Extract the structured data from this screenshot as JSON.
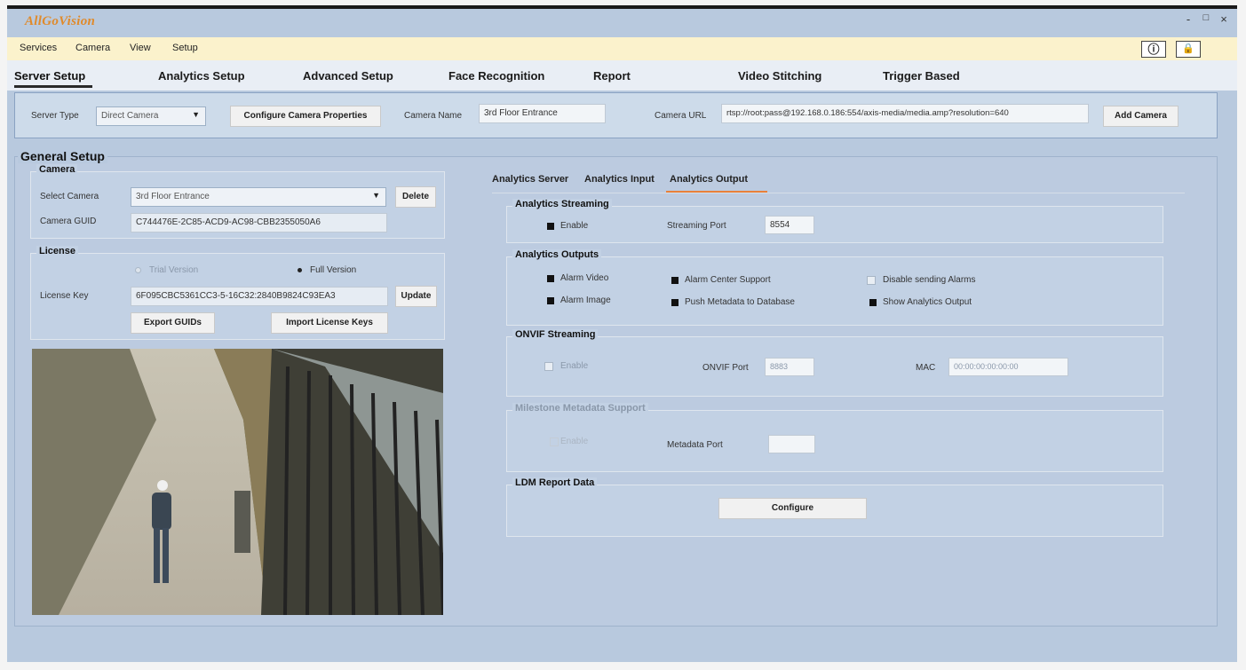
{
  "app": {
    "logo": "AllGoVision",
    "minimize": "-",
    "maximize": "□",
    "close": "×"
  },
  "menu": {
    "items": [
      "Services",
      "Camera",
      "View",
      "Setup"
    ],
    "info_icon": "ⓘ",
    "lock_icon": "🔒"
  },
  "tabs": [
    "Server Setup",
    "Analytics Setup",
    "Advanced Setup",
    "Face Recognition",
    "Report",
    "Video Stitching",
    "Trigger Based"
  ],
  "camera_bar": {
    "server_type_label": "Server Type",
    "server_type_value": "Direct Camera",
    "configure_btn": "Configure Camera Properties",
    "camera_name_label": "Camera Name",
    "camera_name_value": "3rd Floor Entrance",
    "camera_url_label": "Camera URL",
    "camera_url_value": "rtsp://root:pass@192.168.0.186:554/axis-media/media.amp?resolution=640",
    "add_btn": "Add Camera"
  },
  "general": {
    "title": "General Setup",
    "camera": {
      "caption": "Camera",
      "select_label": "Select Camera",
      "select_value": "3rd Floor Entrance",
      "delete_btn": "Delete",
      "guid_label": "Camera GUID",
      "guid_value": "C744476E-2C85-ACD9-AC98-CBB2355050A6"
    },
    "license": {
      "caption": "License",
      "trial": "Trial Version",
      "full": "Full Version",
      "key_label": "License Key",
      "key_value": "6F095CBC5361CC3-5-16C32:2840B9824C93EA3",
      "update_btn": "Update",
      "export_btn": "Export GUIDs",
      "import_btn": "Import License Keys"
    }
  },
  "analytics": {
    "subtabs": [
      "Analytics Server",
      "Analytics Input",
      "Analytics Output"
    ],
    "streaming": {
      "caption": "Analytics Streaming",
      "enable": "Enable",
      "port_label": "Streaming Port",
      "port_value": "8554"
    },
    "outputs": {
      "caption": "Analytics Outputs",
      "alarm_video": "Alarm Video",
      "alarm_image": "Alarm Image",
      "alarm_center": "Alarm Center Support",
      "push_metadata": "Push Metadata to Database",
      "disable_alarms": "Disable sending Alarms",
      "show_output": "Show Analytics Output"
    },
    "onvif": {
      "caption": "ONVIF Streaming",
      "enable": "Enable",
      "port_label": "ONVIF Port",
      "port_value": "8883",
      "mac_label": "MAC",
      "mac_value": "00:00:00:00:00:00"
    },
    "milestone": {
      "caption": "Milestone Metadata Support",
      "enable": "Enable",
      "port_label": "Metadata Port",
      "port_value": ""
    },
    "ldm": {
      "caption": "LDM Report Data",
      "configure_btn": "Configure"
    }
  },
  "colors": {
    "logo": "#e08a2a",
    "accent_tab": "#e8803a",
    "panel": "#b8c9de",
    "menubar": "#fbf2cc"
  }
}
